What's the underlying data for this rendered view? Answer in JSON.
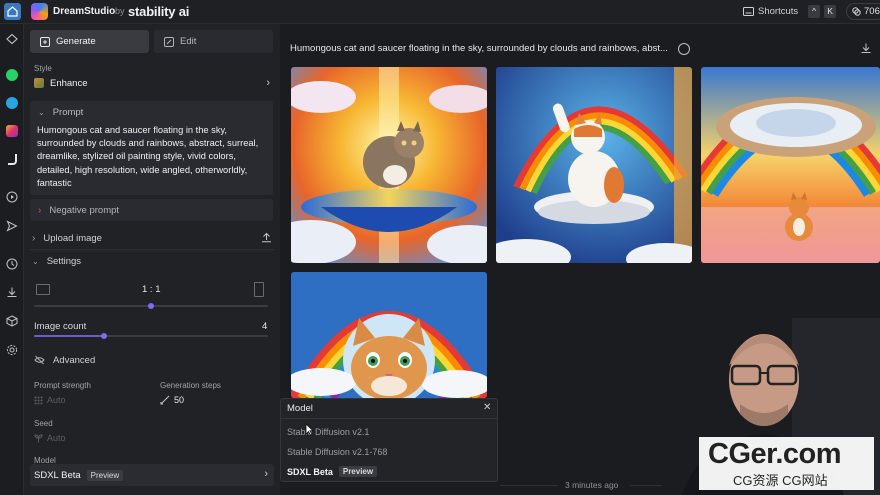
{
  "topbar": {
    "brand_name": "DreamStudio",
    "brand_by": "by",
    "brand_company": "stability ai",
    "shortcuts_label": "Shortcuts",
    "shortcut_keys": [
      "^",
      "K"
    ],
    "credits": "706"
  },
  "panel": {
    "tabs": {
      "generate": "Generate",
      "edit": "Edit"
    },
    "style": {
      "label": "Style",
      "value": "Enhance"
    },
    "prompt": {
      "label": "Prompt",
      "text": "Humongous cat and saucer floating in the sky, surrounded by clouds and rainbows, abstract, surreal, dreamlike, stylized oil painting style, vivid colors, detailed, high resolution, wide angled, otherworldly, fantastic"
    },
    "negative_prompt_label": "Negative prompt",
    "upload_image_label": "Upload image",
    "settings_label": "Settings",
    "aspect_ratio": {
      "value": "1 : 1",
      "fraction": 0.5
    },
    "image_count": {
      "label": "Image count",
      "value": "4",
      "fraction": 0.3
    },
    "advanced_label": "Advanced",
    "prompt_strength": {
      "label": "Prompt strength",
      "value": "Auto"
    },
    "generation_steps": {
      "label": "Generation steps",
      "value": "50"
    },
    "seed": {
      "label": "Seed",
      "value": "Auto"
    },
    "model": {
      "label": "Model",
      "value": "SDXL Beta",
      "badge": "Preview"
    }
  },
  "main": {
    "prompt_title": "Humongous cat and saucer floating in the sky, surrounded by clouds and rainbows, abst...",
    "timestamp": "3 minutes ago"
  },
  "model_dropdown": {
    "title": "Model",
    "close": "✕",
    "options": [
      {
        "label": "Stable Diffusion v2.1",
        "badge": ""
      },
      {
        "label": "Stable Diffusion v2.1-768",
        "badge": ""
      },
      {
        "label": "SDXL Beta",
        "badge": "Preview"
      }
    ]
  },
  "watermark": {
    "main": "CGer.com",
    "sub": "CG资源 CG网站"
  },
  "colors": {
    "accent": "#7c6cf0",
    "panel": "#212226",
    "background": "#1b1c20"
  }
}
